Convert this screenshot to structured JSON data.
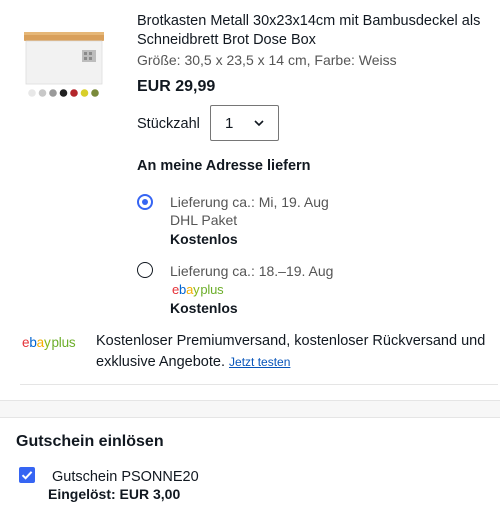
{
  "product": {
    "title": "Brotkasten Metall 30x23x14cm mit Bambusdeckel als Schneidbrett Brot Dose Box",
    "variant": "Größe: 30,5 x 23,5 x 14 cm, Farbe: Weiss",
    "price": "EUR 29,99",
    "image_icon": "bread-box-product-image",
    "color_swatches": [
      "#e8e8e8",
      "#c8c8c8",
      "#9a9a9a",
      "#222222",
      "#b3262b",
      "#d8cf2a",
      "#7a8a3b"
    ]
  },
  "quantity": {
    "label": "Stückzahl",
    "selected": "1"
  },
  "shipping": {
    "heading": "An meine Adresse liefern",
    "options": [
      {
        "selected": true,
        "delivery": "Lieferung ca.: Mi, 19. Aug",
        "carrier": "DHL Paket",
        "cost": "Kostenlos"
      },
      {
        "selected": false,
        "delivery": "Lieferung ca.: 18.–19. Aug",
        "carrier_logo": {
          "word": "ebay",
          "suffix": "plus"
        },
        "cost": "Kostenlos"
      }
    ]
  },
  "ebay_plus": {
    "logo_word": "ebay",
    "logo_suffix": "plus",
    "text": "Kostenloser Premiumversand, kostenloser Rückversand und exklusive Angebote.",
    "link": "Jetzt testen"
  },
  "voucher": {
    "heading": "Gutschein einlösen",
    "checked": true,
    "name": "Gutschein PSONNE20",
    "applied": "Eingelöst: EUR 3,00"
  },
  "colors": {
    "accent": "#3665f3",
    "link": "#0654ba",
    "text": "#111820",
    "muted": "#555555"
  }
}
